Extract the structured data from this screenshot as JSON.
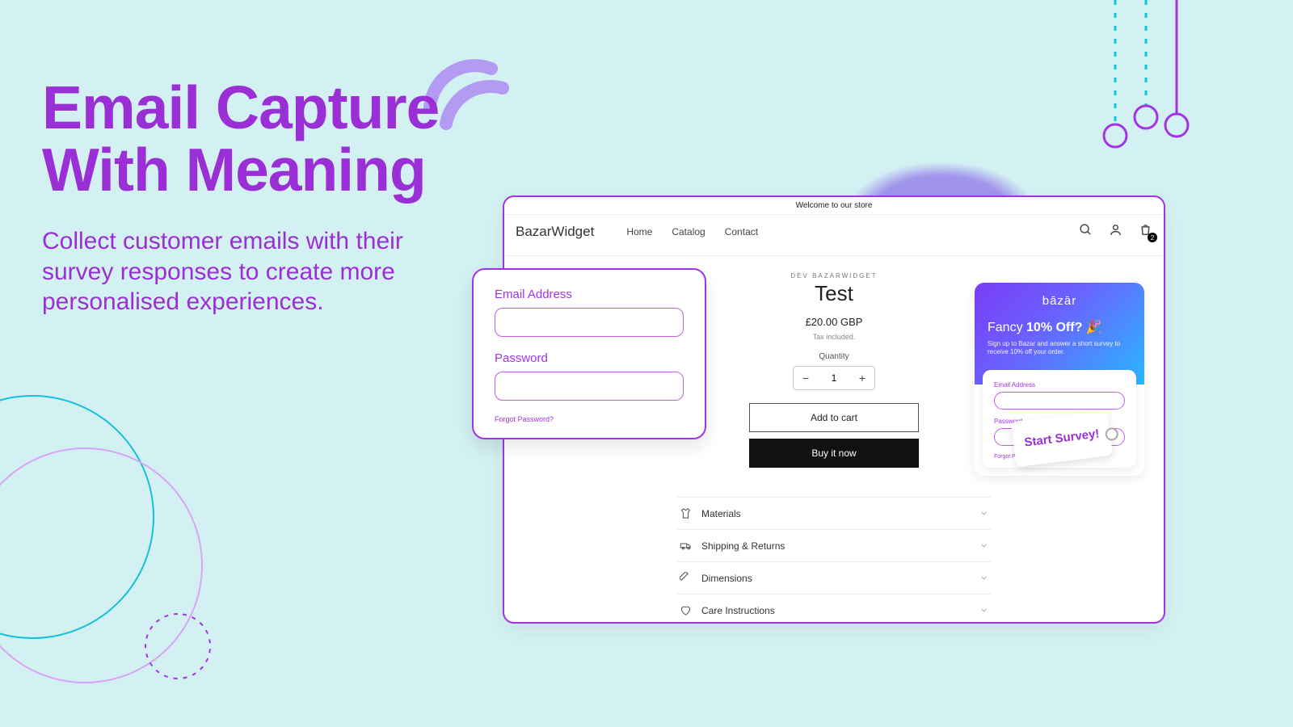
{
  "hero": {
    "title_l1": "Email Capture",
    "title_l2": "With Meaning",
    "subtitle": "Collect customer emails with their survey responses to create more personalised experiences."
  },
  "browser": {
    "announcement": "Welcome to our store",
    "brand": "BazarWidget",
    "nav": {
      "home": "Home",
      "catalog": "Catalog",
      "contact": "Contact"
    },
    "cart_count": "2",
    "product": {
      "vendor": "DEV BAZARWIDGET",
      "title": "Test",
      "price": "£20.00 GBP",
      "tax": "Tax included.",
      "quantity_label": "Quantity",
      "quantity_value": "1",
      "add_to_cart": "Add to cart",
      "buy_now": "Buy it now"
    },
    "accordion": {
      "materials": "Materials",
      "shipping": "Shipping & Returns",
      "dimensions": "Dimensions",
      "care": "Care Instructions"
    }
  },
  "login": {
    "email_label": "Email Address",
    "password_label": "Password",
    "forgot": "Forgot Password?"
  },
  "promo": {
    "logo": "bāzār",
    "title_pre": "Fancy ",
    "title_bold": "10% Off?",
    "title_emoji": " 🎉",
    "subtitle": "Sign up to Bazar and answer a short survey to receive 10% off your order.",
    "email_label": "Email Address",
    "password_label": "Password",
    "forgot": "Forgot Password?",
    "cta": "Start Survey!"
  }
}
